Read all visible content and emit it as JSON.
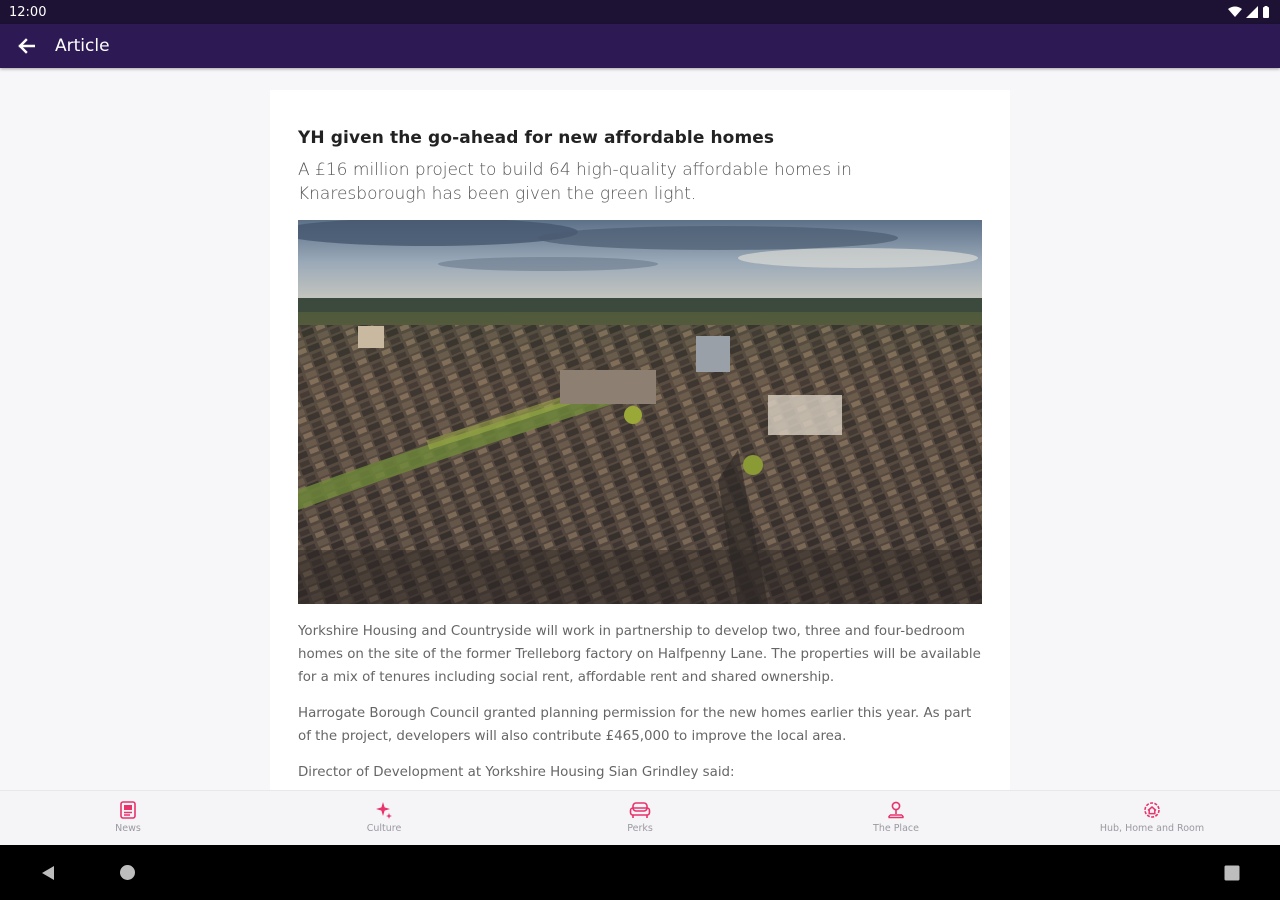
{
  "status_bar": {
    "time": "12:00"
  },
  "app_bar": {
    "title": "Article",
    "back_icon": "arrow-back-icon"
  },
  "article": {
    "headline": "YH given the go-ahead for new affordable homes",
    "subheadline": "A £16 million project to build 64 high-quality affordable homes in Knaresborough has been given the green light.",
    "paragraphs": [
      "Yorkshire Housing and Countryside will work in partnership to develop two, three and four-bedroom homes on the site of the former Trelleborg factory on Halfpenny Lane. The properties will be available for a mix of tenures including social rent, affordable rent and shared ownership.",
      "Harrogate Borough Council granted planning permission for the new homes earlier this year. As part of the project, developers will also contribute £465,000 to improve the local area.",
      "Director of Development at Yorkshire Housing Sian Grindley said:"
    ]
  },
  "bottom_nav": {
    "accent": "#e8336b",
    "items": [
      {
        "label": "News",
        "icon": "newspaper-icon"
      },
      {
        "label": "Culture",
        "icon": "sparkle-icon"
      },
      {
        "label": "Perks",
        "icon": "sofa-icon"
      },
      {
        "label": "The Place",
        "icon": "location-icon"
      },
      {
        "label": "Hub, Home and Room",
        "icon": "home-settings-icon"
      }
    ]
  },
  "colors": {
    "status_bar": "#1d1233",
    "app_bar": "#2d1a55",
    "background": "#f7f7f9"
  }
}
